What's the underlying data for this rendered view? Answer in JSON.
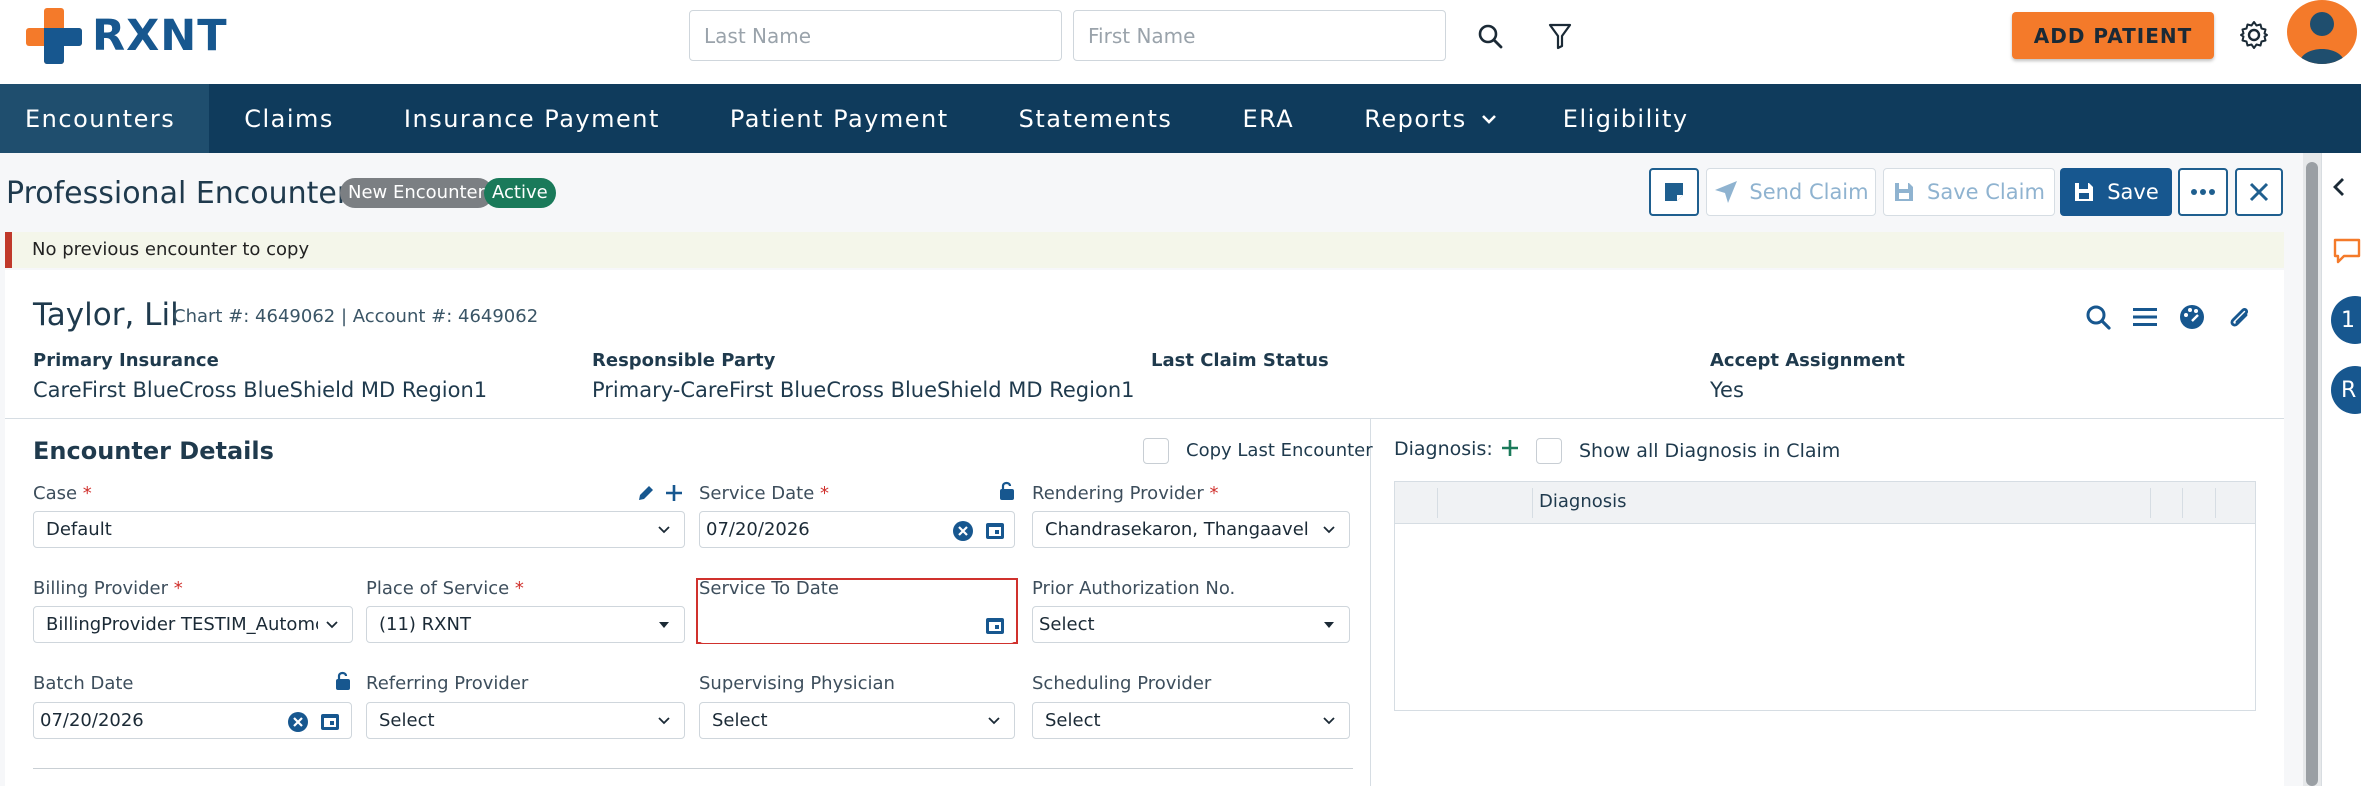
{
  "brand": {
    "name": "RXNT"
  },
  "search": {
    "last_name_placeholder": "Last Name",
    "first_name_placeholder": "First Name"
  },
  "header": {
    "add_patient_label": "ADD PATIENT"
  },
  "nav": {
    "items": [
      {
        "label": "Encounters"
      },
      {
        "label": "Claims"
      },
      {
        "label": "Insurance Payment"
      },
      {
        "label": "Patient Payment"
      },
      {
        "label": "Statements"
      },
      {
        "label": "ERA"
      },
      {
        "label": "Reports"
      },
      {
        "label": "Eligibility"
      }
    ]
  },
  "page": {
    "title": "Professional Encounter",
    "badge_new": "New Encounter",
    "badge_status": "Active",
    "send_claim_label": "Send Claim",
    "save_claim_label": "Save Claim",
    "save_label": "Save"
  },
  "alert": {
    "message": "No previous encounter to copy"
  },
  "patient": {
    "name": "Taylor, Lil",
    "meta": "Chart #: 4649062  |  Account #: 4649062",
    "primary_insurance_label": "Primary Insurance",
    "primary_insurance_value": "CareFirst BlueCross BlueShield MD Region1",
    "responsible_party_label": "Responsible Party",
    "responsible_party_value": "Primary-CareFirst BlueCross BlueShield MD Region1",
    "last_claim_status_label": "Last Claim Status",
    "last_claim_status_value": "",
    "accept_assignment_label": "Accept Assignment",
    "accept_assignment_value": "Yes"
  },
  "encounter": {
    "title": "Encounter Details",
    "copy_last_label": "Copy Last Encounter",
    "case_label": "Case",
    "case_value": "Default",
    "service_date_label": "Service Date",
    "service_date_value": "07/20/2026",
    "rendering_provider_label": "Rendering Provider",
    "rendering_provider_value": "Chandrasekaron, Thangaavel",
    "billing_provider_label": "Billing Provider",
    "billing_provider_value": "BillingProvider TESTIM_Automc",
    "place_of_service_label": "Place of Service",
    "place_of_service_value": "(11) RXNT",
    "service_to_date_label": "Service To Date",
    "service_to_date_value": "",
    "prior_auth_label": "Prior Authorization No.",
    "prior_auth_value": "Select",
    "batch_date_label": "Batch Date",
    "batch_date_value": "07/20/2026",
    "referring_provider_label": "Referring Provider",
    "referring_provider_value": "Select",
    "supervising_physician_label": "Supervising Physician",
    "supervising_physician_value": "Select",
    "scheduling_provider_label": "Scheduling Provider",
    "scheduling_provider_value": "Select",
    "required_mark": "*"
  },
  "diagnosis": {
    "label": "Diagnosis:",
    "show_all_label": "Show all Diagnosis in Claim",
    "column_header": "Diagnosis"
  },
  "side": {
    "badge_1": "1",
    "badge_2": "R"
  },
  "colors": {
    "brand_blue": "#17578f",
    "brand_orange": "#f47a2a",
    "nav_bg": "#0f3b5c",
    "active_badge": "#1a7a5a",
    "required": "#d0312d"
  }
}
